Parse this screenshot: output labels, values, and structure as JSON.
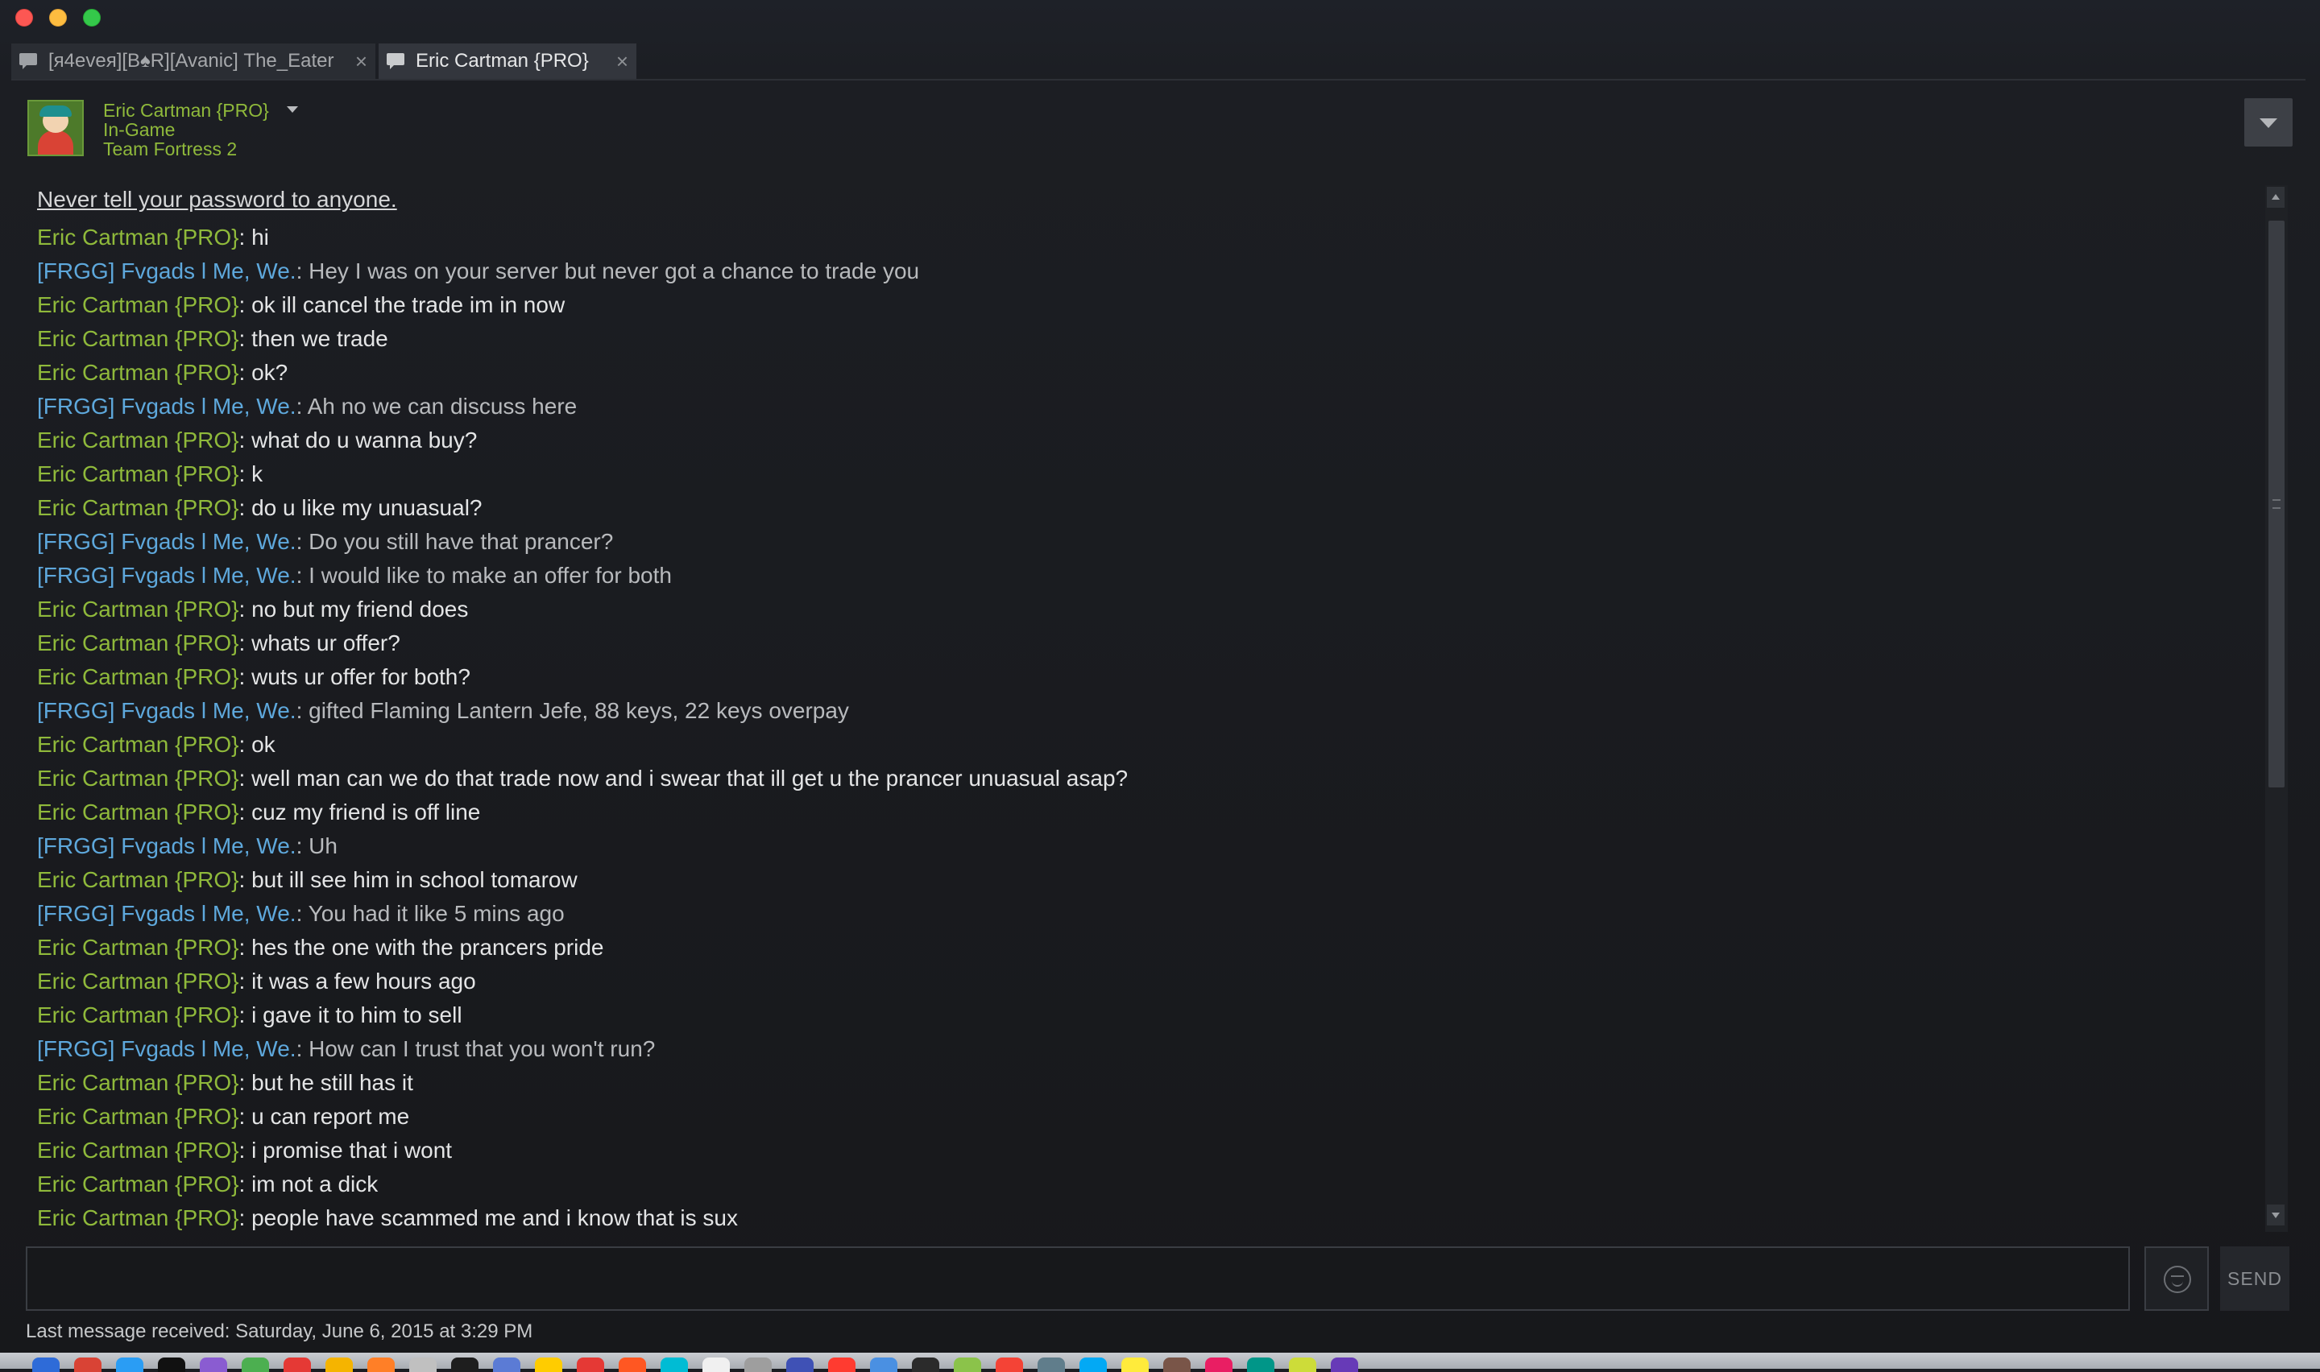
{
  "tabs": [
    {
      "label": "[я4eveя][B♠R][Avanic] The_Eater",
      "close": "×"
    },
    {
      "label": "Eric Cartman {PRO}",
      "close": "×"
    }
  ],
  "contact": {
    "name": "Eric Cartman {PRO}",
    "status": "In-Game",
    "game": "Team Fortress 2"
  },
  "chat": {
    "notice": "Never tell your password to anyone.",
    "messages": [
      {
        "from": "Eric Cartman {PRO}",
        "text": ": hi",
        "self": false
      },
      {
        "from": "[FRGG] Fvgads l Me, We.",
        "text": ": Hey I was on your server but never got a chance to trade you",
        "self": true
      },
      {
        "from": "Eric Cartman {PRO}",
        "text": ": ok ill cancel the trade im in now",
        "self": false
      },
      {
        "from": "Eric Cartman {PRO}",
        "text": ": then we trade",
        "self": false
      },
      {
        "from": "Eric Cartman {PRO}",
        "text": ": ok?",
        "self": false
      },
      {
        "from": "[FRGG] Fvgads l Me, We.",
        "text": ": Ah no we can discuss here",
        "self": true
      },
      {
        "from": "Eric Cartman {PRO}",
        "text": ": what do u wanna buy?",
        "self": false
      },
      {
        "from": "Eric Cartman {PRO}",
        "text": ": k",
        "self": false
      },
      {
        "from": "Eric Cartman {PRO}",
        "text": ": do u like my unuasual?",
        "self": false
      },
      {
        "from": "[FRGG] Fvgads l Me, We.",
        "text": ": Do you still have that prancer?",
        "self": true
      },
      {
        "from": "[FRGG] Fvgads l Me, We.",
        "text": ": I would like to make an offer for both",
        "self": true
      },
      {
        "from": "Eric Cartman {PRO}",
        "text": ": no but my friend does",
        "self": false
      },
      {
        "from": "Eric Cartman {PRO}",
        "text": ": whats ur offer?",
        "self": false
      },
      {
        "from": "Eric Cartman {PRO}",
        "text": ": wuts ur offer for both?",
        "self": false
      },
      {
        "from": "[FRGG] Fvgads l Me, We.",
        "text": ": gifted Flaming Lantern Jefe, 88 keys, 22 keys overpay",
        "self": true
      },
      {
        "from": "Eric Cartman {PRO}",
        "text": ": ok",
        "self": false
      },
      {
        "from": "Eric Cartman {PRO}",
        "text": ": well man can we do that trade now and i swear that ill get u the prancer unuasual asap?",
        "self": false
      },
      {
        "from": "Eric Cartman {PRO}",
        "text": ": cuz my friend is off line",
        "self": false
      },
      {
        "from": "[FRGG] Fvgads l Me, We.",
        "text": ": Uh",
        "self": true
      },
      {
        "from": "Eric Cartman {PRO}",
        "text": ": but ill see him in school tomarow",
        "self": false
      },
      {
        "from": "[FRGG] Fvgads l Me, We.",
        "text": ": You had it like 5 mins ago",
        "self": true
      },
      {
        "from": "Eric Cartman {PRO}",
        "text": ": hes the one with the prancers pride",
        "self": false
      },
      {
        "from": "Eric Cartman {PRO}",
        "text": ": it was a few hours ago",
        "self": false
      },
      {
        "from": "Eric Cartman {PRO}",
        "text": ": i gave it to him to sell",
        "self": false
      },
      {
        "from": "[FRGG] Fvgads l Me, We.",
        "text": ": How can I trust that you won't run?",
        "self": true
      },
      {
        "from": "Eric Cartman {PRO}",
        "text": ": but he still has it",
        "self": false
      },
      {
        "from": "Eric Cartman {PRO}",
        "text": ": u can report me",
        "self": false
      },
      {
        "from": "Eric Cartman {PRO}",
        "text": ": i promise that i wont",
        "self": false
      },
      {
        "from": "Eric Cartman {PRO}",
        "text": ": im not a dick",
        "self": false
      },
      {
        "from": "Eric Cartman {PRO}",
        "text": ": people have scammed me and i know that is sux",
        "self": false
      }
    ]
  },
  "composer": {
    "send_label": "SEND"
  },
  "status_line": "Last message received: Saturday, June 6, 2015 at 3:29 PM",
  "colors": {
    "friend_name": "#8fb93b",
    "self_name": "#5ea8dc",
    "background": "#1b1d22"
  },
  "dock_icons": [
    "#2e6bd8",
    "#d94335",
    "#2a9df4",
    "#111111",
    "#8a5cd1",
    "#4caf50",
    "#e53935",
    "#f5b400",
    "#ff7f27",
    "#c0c0c0",
    "#1e1e1e",
    "#5b7bd5",
    "#ffcc00",
    "#e53935",
    "#ff5722",
    "#00bcd4",
    "#f0f0f0",
    "#9e9e9e",
    "#3f51b5",
    "#ff3b30",
    "#4a90e2",
    "#2b2b2b",
    "#8bc34a",
    "#f44336",
    "#607d8b",
    "#03a9f4",
    "#ffeb3b",
    "#795548",
    "#e91e63",
    "#009688",
    "#cddc39",
    "#673ab7"
  ]
}
